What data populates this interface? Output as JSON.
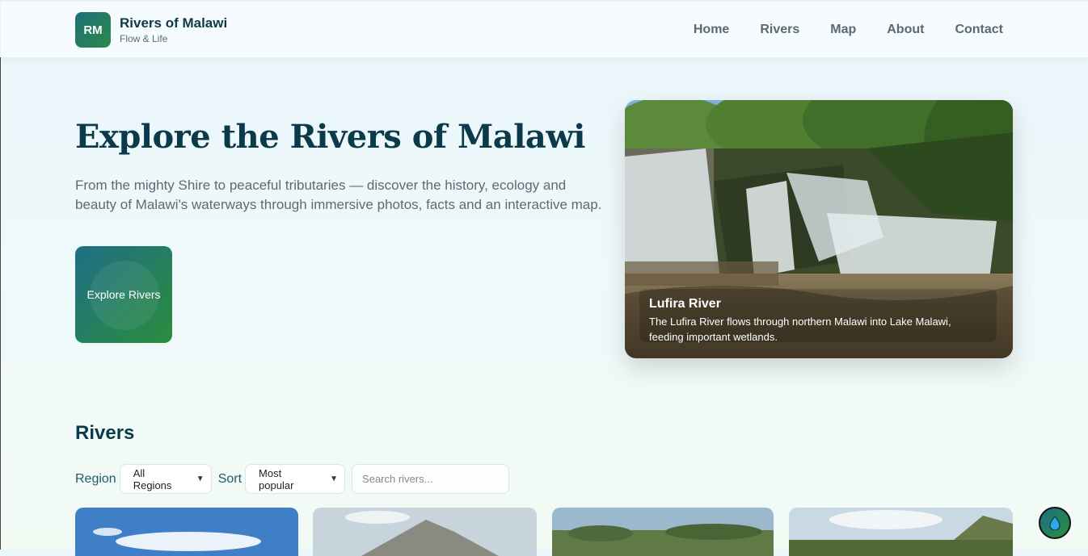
{
  "header": {
    "logo_initials": "RM",
    "brand_name": "Rivers of Malawi",
    "tagline": "Flow & Life",
    "nav": [
      "Home",
      "Rivers",
      "Map",
      "About",
      "Contact"
    ]
  },
  "hero": {
    "title": "Explore the Rivers of Malawi",
    "description": "From the mighty Shire to peaceful tributaries — discover the history, ecology and beauty of Malawi's waterways through immersive photos, facts and an interactive map.",
    "cta_label": "Explore Rivers",
    "featured": {
      "title": "Lufira River",
      "text": "The Lufira River flows through northern Malawi into Lake Malawi, feeding important wetlands."
    }
  },
  "rivers_section": {
    "title": "Rivers",
    "region_label": "Region",
    "region_value": "All Regions",
    "sort_label": "Sort",
    "sort_value": "Most popular",
    "search_placeholder": "Search rivers..."
  },
  "colors": {
    "brand_dark": "#0b3b4a",
    "accent_teal": "#1f6f86",
    "accent_green": "#2a8d3c"
  },
  "icons": {
    "fab": "water-drop-icon"
  }
}
